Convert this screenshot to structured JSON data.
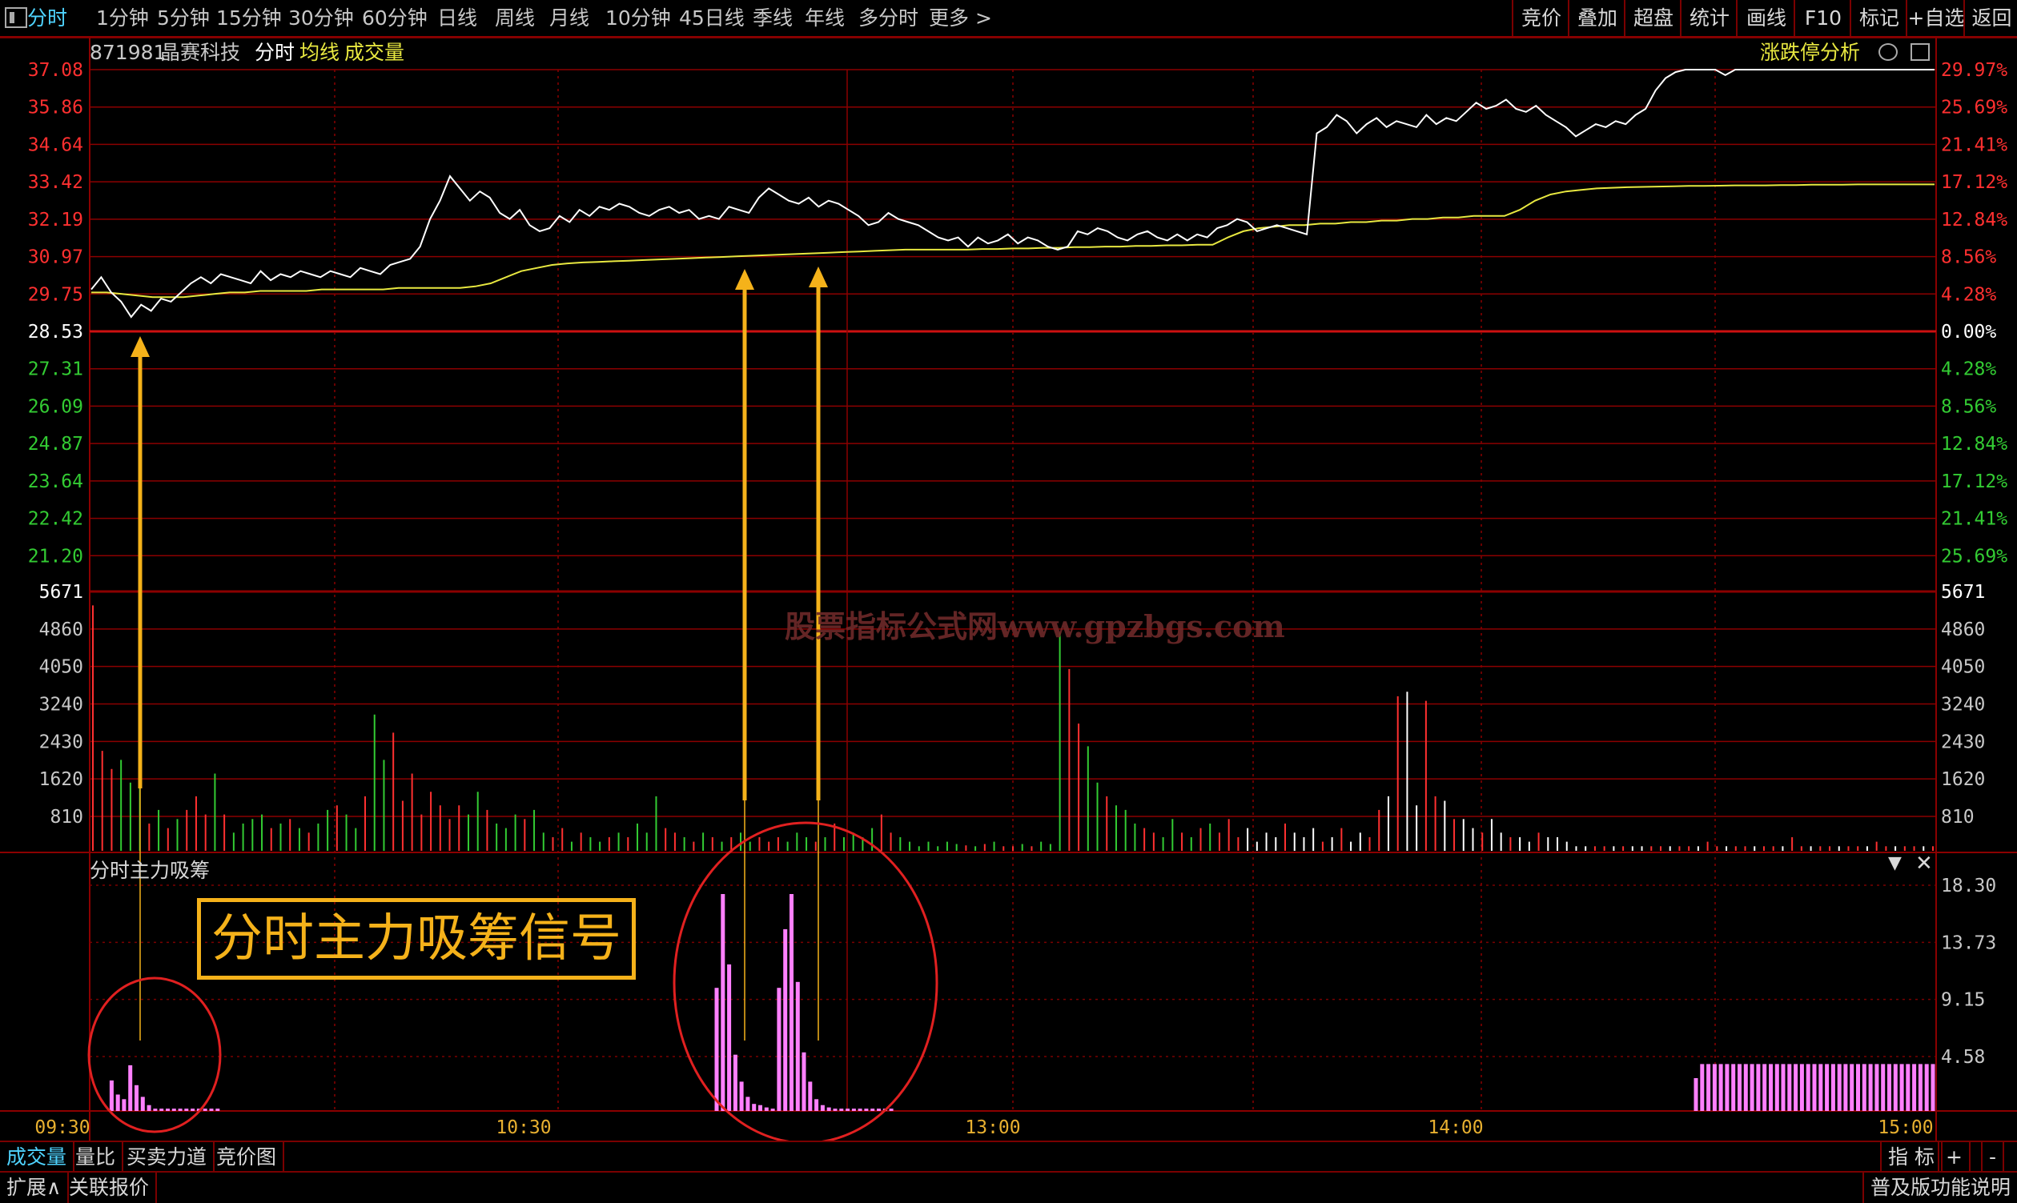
{
  "toolbar": {
    "periods": [
      "分时",
      "1分钟",
      "5分钟",
      "15分钟",
      "30分钟",
      "60分钟",
      "日线",
      "周线",
      "月线",
      "10分钟",
      "45日线",
      "季线",
      "年线",
      "多分时",
      "更多 >"
    ],
    "active_period": "分时",
    "right_buttons": [
      "竞价",
      "叠加",
      "超盘",
      "统计",
      "画线",
      "F10",
      "标记",
      "+自选",
      "返回"
    ]
  },
  "header": {
    "code": "871981",
    "name": "晶赛科技",
    "mode": "分时",
    "avg_label": "均线",
    "vol_label": "成交量",
    "analysis_link": "涨跌停分析"
  },
  "indicator_panel": {
    "title": "分时主力吸筹",
    "annotation": "分时主力吸筹信号"
  },
  "watermark": "股票指标公式网www.gpzbgs.com",
  "bottom_tabs": [
    "成交量",
    "量比",
    "买卖力道",
    "竞价图"
  ],
  "bottom_right": [
    "指 标",
    "+",
    "-"
  ],
  "status": {
    "expand": "扩展∧",
    "related": "关联报价",
    "help": "普及版功能说明"
  },
  "colors": {
    "up": "#ff3030",
    "down": "#33cc33",
    "grid": "#8b0000",
    "price": "#ffffff",
    "avg": "#e8e840",
    "signal": "#ff80ff",
    "arrow": "#f5b21a",
    "circle": "#e02020",
    "cyan": "#4fd3ff"
  },
  "chart_data": [
    {
      "type": "line",
      "title": "",
      "base_price": 28.53,
      "price_ticks_left": [
        "37.08",
        "35.86",
        "34.64",
        "33.42",
        "32.19",
        "30.97",
        "29.75",
        "28.53",
        "27.31",
        "26.09",
        "24.87",
        "23.64",
        "22.42",
        "21.20"
      ],
      "pct_ticks_right": [
        "29.97%",
        "25.69%",
        "21.41%",
        "17.12%",
        "12.84%",
        "8.56%",
        "4.28%",
        "0.00%",
        "4.28%",
        "8.56%",
        "12.84%",
        "17.12%",
        "21.41%",
        "25.69%"
      ],
      "time_ticks": [
        "09:30",
        "10:30",
        "13:00",
        "14:00",
        "15:00"
      ],
      "ylim": [
        21.2,
        37.08
      ],
      "series": [
        {
          "name": "分时",
          "values": [
            29.9,
            30.3,
            29.8,
            29.5,
            29.0,
            29.4,
            29.2,
            29.6,
            29.5,
            29.8,
            30.1,
            30.3,
            30.1,
            30.4,
            30.3,
            30.2,
            30.1,
            30.5,
            30.2,
            30.4,
            30.3,
            30.5,
            30.4,
            30.3,
            30.5,
            30.4,
            30.3,
            30.6,
            30.5,
            30.4,
            30.7,
            30.8,
            30.9,
            31.3,
            32.2,
            32.8,
            33.6,
            33.2,
            32.8,
            33.1,
            32.9,
            32.4,
            32.2,
            32.5,
            32.0,
            31.8,
            31.9,
            32.3,
            32.1,
            32.5,
            32.3,
            32.6,
            32.5,
            32.7,
            32.6,
            32.4,
            32.3,
            32.5,
            32.6,
            32.4,
            32.5,
            32.2,
            32.3,
            32.2,
            32.6,
            32.5,
            32.4,
            32.9,
            33.2,
            33.0,
            32.8,
            32.7,
            32.9,
            32.6,
            32.8,
            32.7,
            32.5,
            32.3,
            32.0,
            32.1,
            32.4,
            32.2,
            32.1,
            32.0,
            31.8,
            31.6,
            31.5,
            31.6,
            31.3,
            31.6,
            31.4,
            31.5,
            31.7,
            31.4,
            31.6,
            31.5,
            31.3,
            31.2,
            31.3,
            31.8,
            31.7,
            31.9,
            31.8,
            31.6,
            31.5,
            31.7,
            31.8,
            31.6,
            31.5,
            31.7,
            31.5,
            31.7,
            31.6,
            31.9,
            32.0,
            32.2,
            32.1,
            31.8,
            31.9,
            32.0,
            31.9,
            31.8,
            31.7,
            35.0,
            35.2,
            35.6,
            35.4,
            35.0,
            35.3,
            35.5,
            35.2,
            35.4,
            35.3,
            35.2,
            35.6,
            35.3,
            35.5,
            35.4,
            35.7,
            36.0,
            35.8,
            35.9,
            36.1,
            35.8,
            35.7,
            35.9,
            35.6,
            35.4,
            35.2,
            34.9,
            35.1,
            35.3,
            35.2,
            35.4,
            35.3,
            35.6,
            35.8,
            36.4,
            36.8,
            37.0,
            37.08,
            37.08,
            37.08,
            37.08,
            36.9,
            37.08,
            37.08,
            37.08,
            37.08,
            37.08,
            37.08,
            37.08,
            37.08,
            37.08,
            37.08,
            37.08,
            37.08,
            37.08,
            37.08,
            37.08,
            37.08,
            37.08,
            37.08,
            37.08,
            37.08,
            37.08
          ]
        },
        {
          "name": "均线",
          "values": [
            29.8,
            29.8,
            29.75,
            29.7,
            29.65,
            29.65,
            29.65,
            29.7,
            29.75,
            29.8,
            29.8,
            29.85,
            29.85,
            29.85,
            29.85,
            29.9,
            29.9,
            29.9,
            29.9,
            29.9,
            29.95,
            29.95,
            29.95,
            29.95,
            29.95,
            30.0,
            30.1,
            30.3,
            30.5,
            30.6,
            30.7,
            30.75,
            30.78,
            30.8,
            30.82,
            30.84,
            30.86,
            30.88,
            30.9,
            30.92,
            30.94,
            30.96,
            30.98,
            31.0,
            31.02,
            31.04,
            31.06,
            31.08,
            31.1,
            31.12,
            31.14,
            31.16,
            31.18,
            31.2,
            31.2,
            31.2,
            31.2,
            31.2,
            31.22,
            31.22,
            31.24,
            31.24,
            31.26,
            31.26,
            31.28,
            31.28,
            31.3,
            31.3,
            31.32,
            31.32,
            31.34,
            31.34,
            31.36,
            31.36,
            31.6,
            31.8,
            31.9,
            31.95,
            32.0,
            32.0,
            32.05,
            32.05,
            32.1,
            32.1,
            32.15,
            32.15,
            32.2,
            32.2,
            32.25,
            32.25,
            32.3,
            32.3,
            32.3,
            32.5,
            32.8,
            33.0,
            33.1,
            33.15,
            33.2,
            33.22,
            33.24,
            33.25,
            33.26,
            33.27,
            33.28,
            33.28,
            33.29,
            33.3,
            33.3,
            33.3,
            33.31,
            33.31,
            33.32,
            33.32,
            33.32,
            33.33,
            33.33,
            33.33,
            33.33,
            33.33,
            33.33
          ]
        }
      ]
    },
    {
      "type": "bar",
      "title": "成交量",
      "y_ticks": [
        "5671",
        "4860",
        "4050",
        "3240",
        "2430",
        "1620",
        "810"
      ],
      "ylim": [
        0,
        5671
      ],
      "series": [
        {
          "name": "成交量",
          "values": [
            5400,
            2200,
            1800,
            2000,
            1500,
            1600,
            600,
            900,
            500,
            700,
            900,
            1200,
            800,
            1700,
            800,
            400,
            600,
            700,
            800,
            500,
            600,
            700,
            500,
            400,
            600,
            900,
            1000,
            800,
            500,
            1200,
            3000,
            2000,
            2600,
            1100,
            1700,
            800,
            1300,
            1000,
            700,
            1000,
            800,
            1300,
            900,
            600,
            500,
            800,
            700,
            900,
            400,
            300,
            500,
            200,
            400,
            300,
            200,
            300,
            400,
            300,
            600,
            400,
            1200,
            500,
            400,
            300,
            200,
            400,
            300,
            200,
            300,
            400,
            200,
            300,
            200,
            300,
            200,
            400,
            300,
            200,
            300,
            600,
            300,
            400,
            300,
            500,
            800,
            400,
            300,
            200,
            100,
            200,
            100,
            200,
            150,
            120,
            100,
            150,
            200,
            100,
            100,
            150,
            100,
            200,
            150,
            4800,
            4000,
            2800,
            2300,
            1500,
            1200,
            1000,
            900,
            600,
            500,
            400,
            300,
            700,
            400,
            300,
            500,
            600,
            400,
            700,
            300,
            500,
            200,
            400,
            300,
            600,
            400,
            300,
            500,
            200,
            300,
            500,
            200,
            400,
            300,
            900,
            1200,
            3400,
            3500,
            1000,
            3300,
            1200,
            1100,
            700,
            700,
            500,
            400,
            700,
            400,
            300,
            300,
            200,
            400,
            300,
            300,
            200,
            100,
            100,
            100,
            100,
            100,
            100,
            100,
            100,
            100,
            100,
            100,
            100,
            100,
            100,
            200,
            100,
            100,
            100,
            100,
            100,
            100,
            100,
            100,
            300,
            100,
            100,
            100,
            100,
            100,
            100,
            100,
            100,
            200,
            100,
            100,
            100,
            100,
            100,
            100
          ]
        }
      ]
    },
    {
      "type": "bar",
      "title": "分时主力吸筹",
      "y_ticks": [
        "18.30",
        "13.73",
        "9.15",
        "4.58"
      ],
      "ylim": [
        0,
        20
      ],
      "series": [
        {
          "name": "分时主力吸筹",
          "values": [
            0,
            0,
            0,
            2.6,
            1.4,
            1.0,
            3.9,
            2.2,
            1.2,
            0.5,
            0.2,
            0.2,
            0.2,
            0.2,
            0.2,
            0.2,
            0.2,
            0.2,
            0.2,
            0.2,
            0.2,
            0,
            0,
            0,
            0,
            0,
            0,
            0,
            0,
            0,
            0,
            0,
            0,
            0,
            0,
            0,
            0,
            0,
            0,
            0,
            0,
            0,
            0,
            0,
            0,
            0,
            0,
            0,
            0,
            0,
            0,
            0,
            0,
            0,
            0,
            0,
            0,
            0,
            0,
            0,
            0,
            0,
            0,
            0,
            0,
            0,
            0,
            0,
            0,
            0,
            0,
            0,
            0,
            0,
            0,
            0,
            0,
            0,
            0,
            0,
            0,
            0,
            0,
            0,
            0,
            0,
            0,
            0,
            0,
            0,
            0,
            0,
            0,
            0,
            0,
            0,
            0,
            0,
            0,
            0,
            10.5,
            18.5,
            12.5,
            4.8,
            2.5,
            1.2,
            0.6,
            0.5,
            0.3,
            0.2,
            10.5,
            15.5,
            18.5,
            11.0,
            5.0,
            2.5,
            1.0,
            0.5,
            0.3,
            0.2,
            0.2,
            0.2,
            0.2,
            0.2,
            0.2,
            0.2,
            0.2,
            0.2,
            0.2,
            0,
            0,
            0,
            0,
            0,
            0,
            0,
            0,
            0,
            0,
            0,
            0,
            0,
            0,
            0,
            0,
            0,
            0,
            0,
            0,
            0,
            0,
            0,
            0,
            0,
            0,
            0,
            0,
            0,
            0,
            0,
            0,
            0,
            0,
            0,
            0,
            0,
            0,
            0,
            0,
            0,
            0,
            0,
            0,
            0,
            0,
            0,
            0,
            0,
            0,
            0,
            0,
            0,
            0,
            0,
            0,
            0,
            0,
            0,
            0,
            0,
            0,
            0,
            0,
            0,
            0,
            0,
            0,
            0,
            0,
            0,
            0,
            0,
            0,
            0,
            0,
            0,
            0,
            0,
            0,
            0,
            0,
            0,
            0,
            0,
            0,
            0,
            0,
            0,
            0,
            0,
            0,
            0,
            0,
            0,
            0,
            0,
            0,
            0,
            0,
            0,
            0,
            0,
            0,
            0,
            0,
            0,
            0,
            0,
            0,
            0,
            0,
            0,
            0,
            0,
            0,
            0,
            0,
            0,
            0,
            0,
            0,
            0,
            0,
            0,
            0,
            0,
            0,
            2.8,
            4.0,
            4.0,
            4.0,
            4.0,
            4.0,
            4.0,
            4.0,
            4.0,
            4.0,
            4.0,
            4.0,
            4.0,
            4.0,
            4.0,
            4.0,
            4.0,
            4.0,
            4.0,
            4.0,
            4.0,
            4.0,
            4.0,
            4.0,
            4.0,
            4.0,
            4.0,
            4.0,
            4.0,
            4.0,
            4.0,
            4.0,
            4.0,
            4.0,
            4.0,
            4.0,
            4.0,
            4.0,
            4.0
          ]
        }
      ]
    }
  ]
}
